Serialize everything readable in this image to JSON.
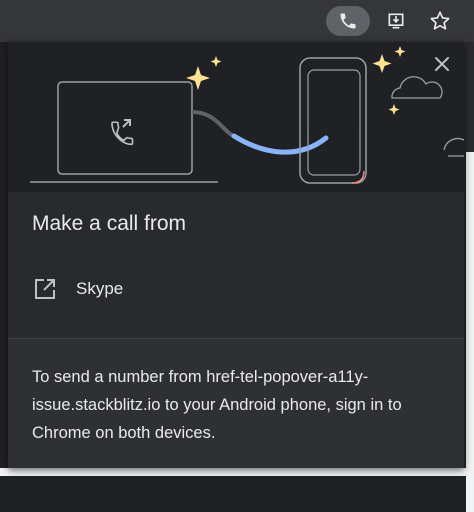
{
  "toolbar": {
    "icons": [
      "phone-icon",
      "install-icon",
      "star-icon"
    ]
  },
  "popover": {
    "title": "Make a call from",
    "close_icon": "close-icon",
    "options": [
      {
        "label": "Skype",
        "icon": "open-in-new-icon"
      }
    ],
    "footer_text": "To send a number from href-tel-popover-a11y-issue.stackblitz.io to your Android phone, sign in to Chrome on both devices."
  },
  "colors": {
    "accent_blue": "#8ab4f8",
    "star_yellow": "#fde293",
    "text": "#e8eaed",
    "popover_bg": "#292a2d",
    "hero_bg": "#202124"
  }
}
